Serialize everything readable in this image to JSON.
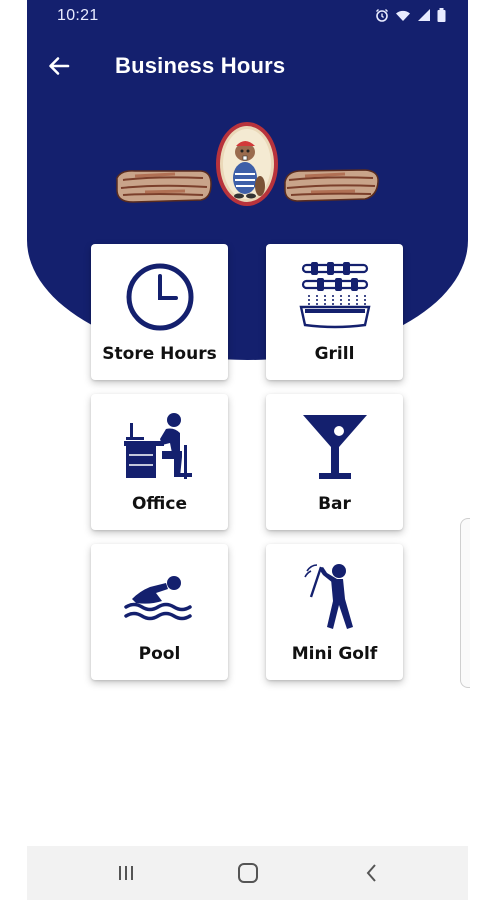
{
  "status_bar": {
    "time": "10:21",
    "icons": [
      "alarm-icon",
      "wifi-icon",
      "signal-icon",
      "battery-icon"
    ]
  },
  "app_bar": {
    "title": "Business Hours",
    "back_icon": "arrow-left-icon"
  },
  "colors": {
    "header": "#14206e",
    "icon": "#14206e",
    "card_bg": "#ffffff",
    "label": "#111111"
  },
  "cards": [
    {
      "label": "Store Hours",
      "icon": "clock-icon"
    },
    {
      "label": "Grill",
      "icon": "grill-icon"
    },
    {
      "label": "Office",
      "icon": "office-desk-icon"
    },
    {
      "label": "Bar",
      "icon": "cocktail-icon"
    },
    {
      "label": "Pool",
      "icon": "swimmer-icon"
    },
    {
      "label": "Mini Golf",
      "icon": "golfer-icon"
    }
  ],
  "nav_bar": {
    "buttons": [
      "recent-apps-icon",
      "home-icon",
      "back-icon"
    ]
  }
}
